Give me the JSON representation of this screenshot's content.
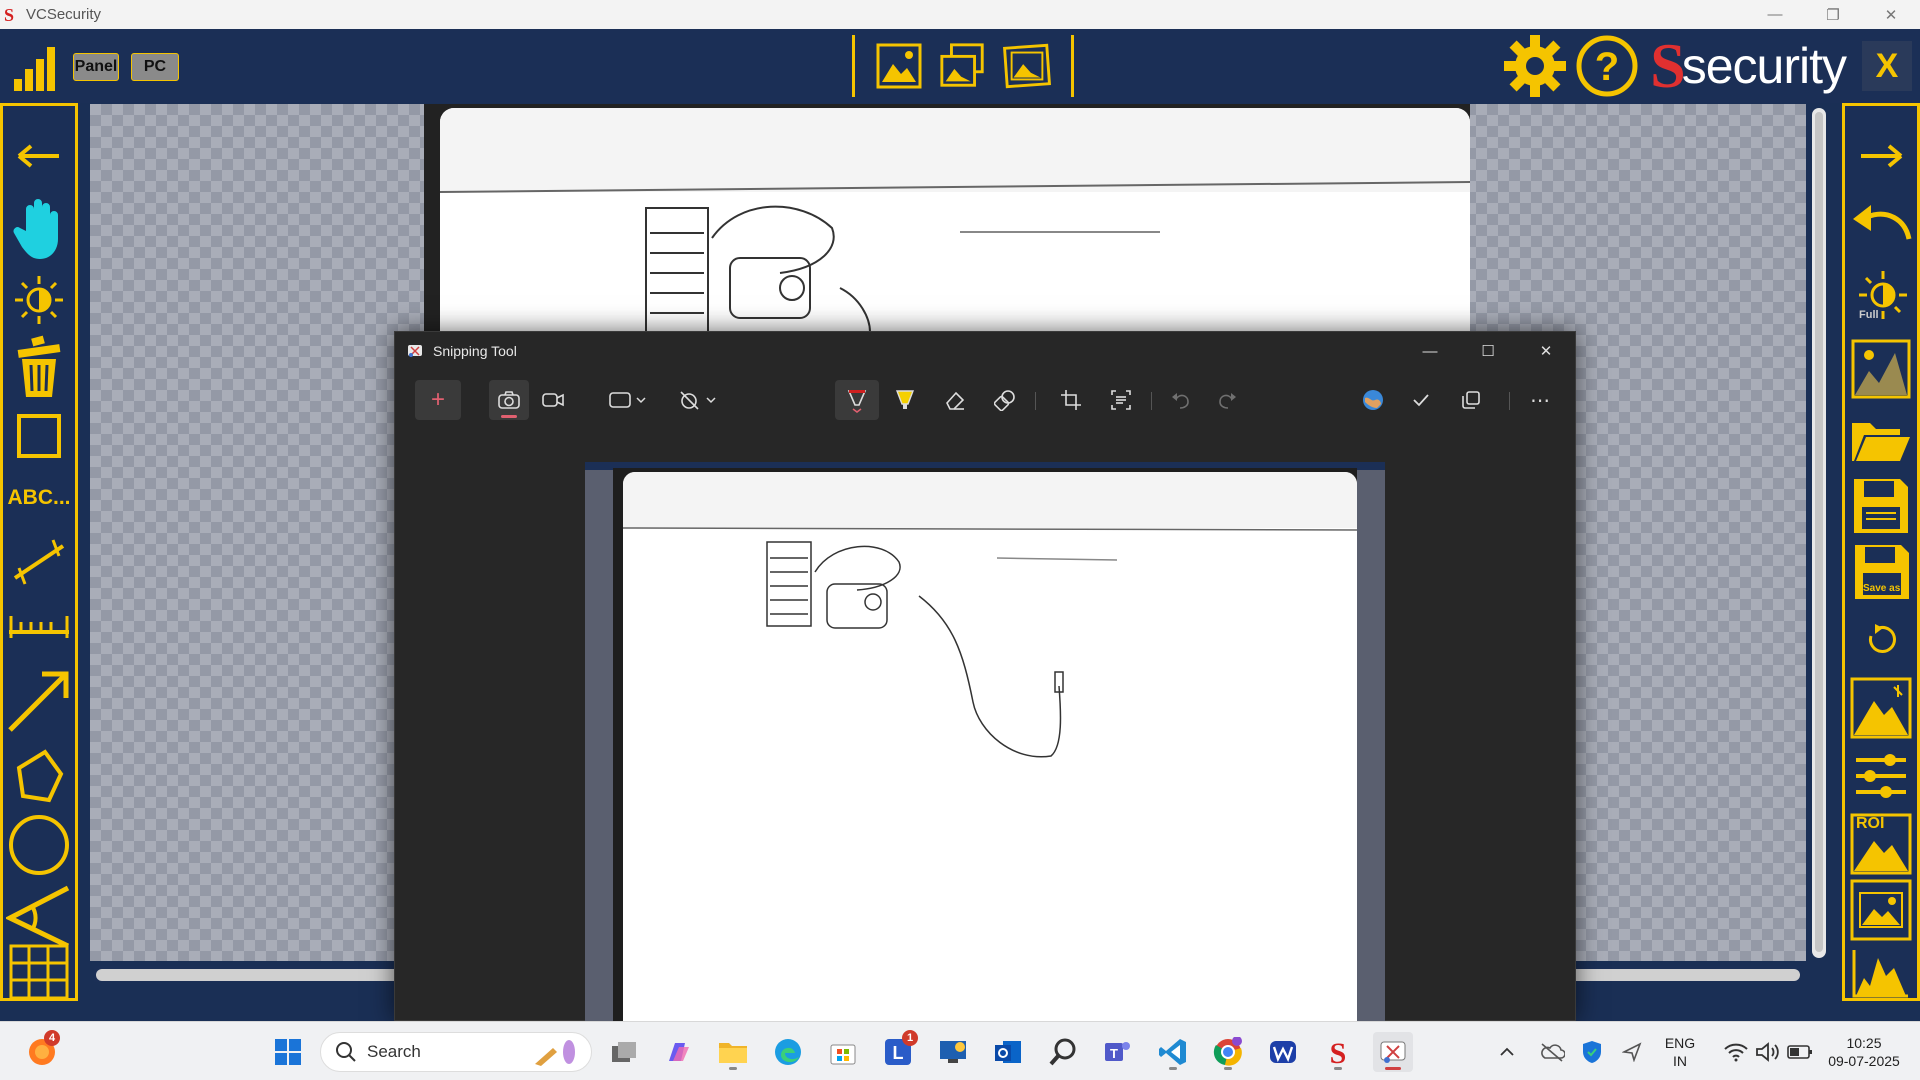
{
  "app": {
    "title": "VCSecurity"
  },
  "header": {
    "panel_label": "Panel",
    "pc_label": "PC",
    "brand": "security",
    "close_label": "X",
    "colors": {
      "accent": "#f5c400",
      "navy": "#1b2f56",
      "brand_red": "#e03030"
    }
  },
  "left_tools": [
    {
      "name": "back-arrow-icon",
      "label": ""
    },
    {
      "name": "hand-pan-icon",
      "label": ""
    },
    {
      "name": "brightness-icon",
      "label": ""
    },
    {
      "name": "trash-icon",
      "label": ""
    },
    {
      "name": "rectangle-icon",
      "label": ""
    },
    {
      "name": "text-tool",
      "label": "ABC..."
    },
    {
      "name": "line-measure-icon",
      "label": ""
    },
    {
      "name": "ruler-icon",
      "label": ""
    },
    {
      "name": "arrow-tool-icon",
      "label": ""
    },
    {
      "name": "polygon-icon",
      "label": ""
    },
    {
      "name": "circle-icon",
      "label": ""
    },
    {
      "name": "angle-icon",
      "label": ""
    },
    {
      "name": "grid-icon",
      "label": ""
    }
  ],
  "right_tools": {
    "brightness_full_label": "Full",
    "save_as_label": "Save as",
    "roi_label": "ROI"
  },
  "snipping_tool": {
    "title": "Snipping Tool"
  },
  "taskbar": {
    "search_label": "Search",
    "firefox_badge": "4",
    "teams_badge": "1",
    "lang_line1": "ENG",
    "lang_line2": "IN",
    "time": "10:25",
    "date": "09-07-2025"
  }
}
